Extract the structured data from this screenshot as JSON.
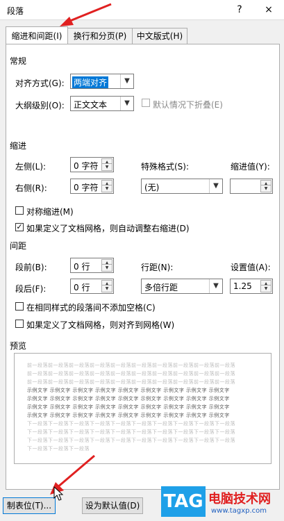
{
  "window": {
    "title": "段落",
    "help": "?",
    "close": "×"
  },
  "tabs": [
    {
      "label": "缩进和间距(I)"
    },
    {
      "label": "换行和分页(P)"
    },
    {
      "label": "中文版式(H)"
    }
  ],
  "general": {
    "title": "常规",
    "alignment_label": "对齐方式(G):",
    "alignment_value": "两端对齐",
    "outline_label": "大纲级别(O):",
    "outline_value": "正文文本",
    "collapsed_label": "默认情况下折叠(E)"
  },
  "indent": {
    "title": "缩进",
    "left_label": "左侧(L):",
    "left_value": "0 字符",
    "right_label": "右侧(R):",
    "right_value": "0 字符",
    "special_label": "特殊格式(S):",
    "special_value": "(无)",
    "by_label": "缩进值(Y):",
    "by_value": "",
    "mirror_label": "对称缩进(M)",
    "auto_adjust_label": "如果定义了文档网格，则自动调整右缩进(D)"
  },
  "spacing": {
    "title": "间距",
    "before_label": "段前(B):",
    "before_value": "0 行",
    "after_label": "段后(F):",
    "after_value": "0 行",
    "line_label": "行距(N):",
    "line_value": "多倍行距",
    "at_label": "设置值(A):",
    "at_value": "1.25",
    "no_space_label": "在相同样式的段落间不添加空格(C)",
    "snap_grid_label": "如果定义了文档网格，则对齐到网格(W)"
  },
  "preview": {
    "title": "预览",
    "prev_line": "前一段落前一段落前一段落前一段落前一段落前一段落前一段落前一段落前一段落前一段落",
    "sample_line": "示例文字 示例文字 示例文字 示例文字 示例文字 示例文字 示例文字 示例文字 示例文字",
    "sample_last": "示例文字 示例文字 示例文字 示例文字 示例文字 示例文字 示例文字 示例文字 示例文字",
    "next_line": "下一段落下一段落下一段落下一段落下一段落下一段落下一段落下一段落下一段落下一段落",
    "next_last": "下一段落下一段落下一段落"
  },
  "buttons": {
    "tabs": "制表位(T)...",
    "default": "设为默认值(D)"
  },
  "watermark": {
    "tag": "TAG",
    "site": "电脑技术网",
    "url": "www.tagxp.com"
  }
}
